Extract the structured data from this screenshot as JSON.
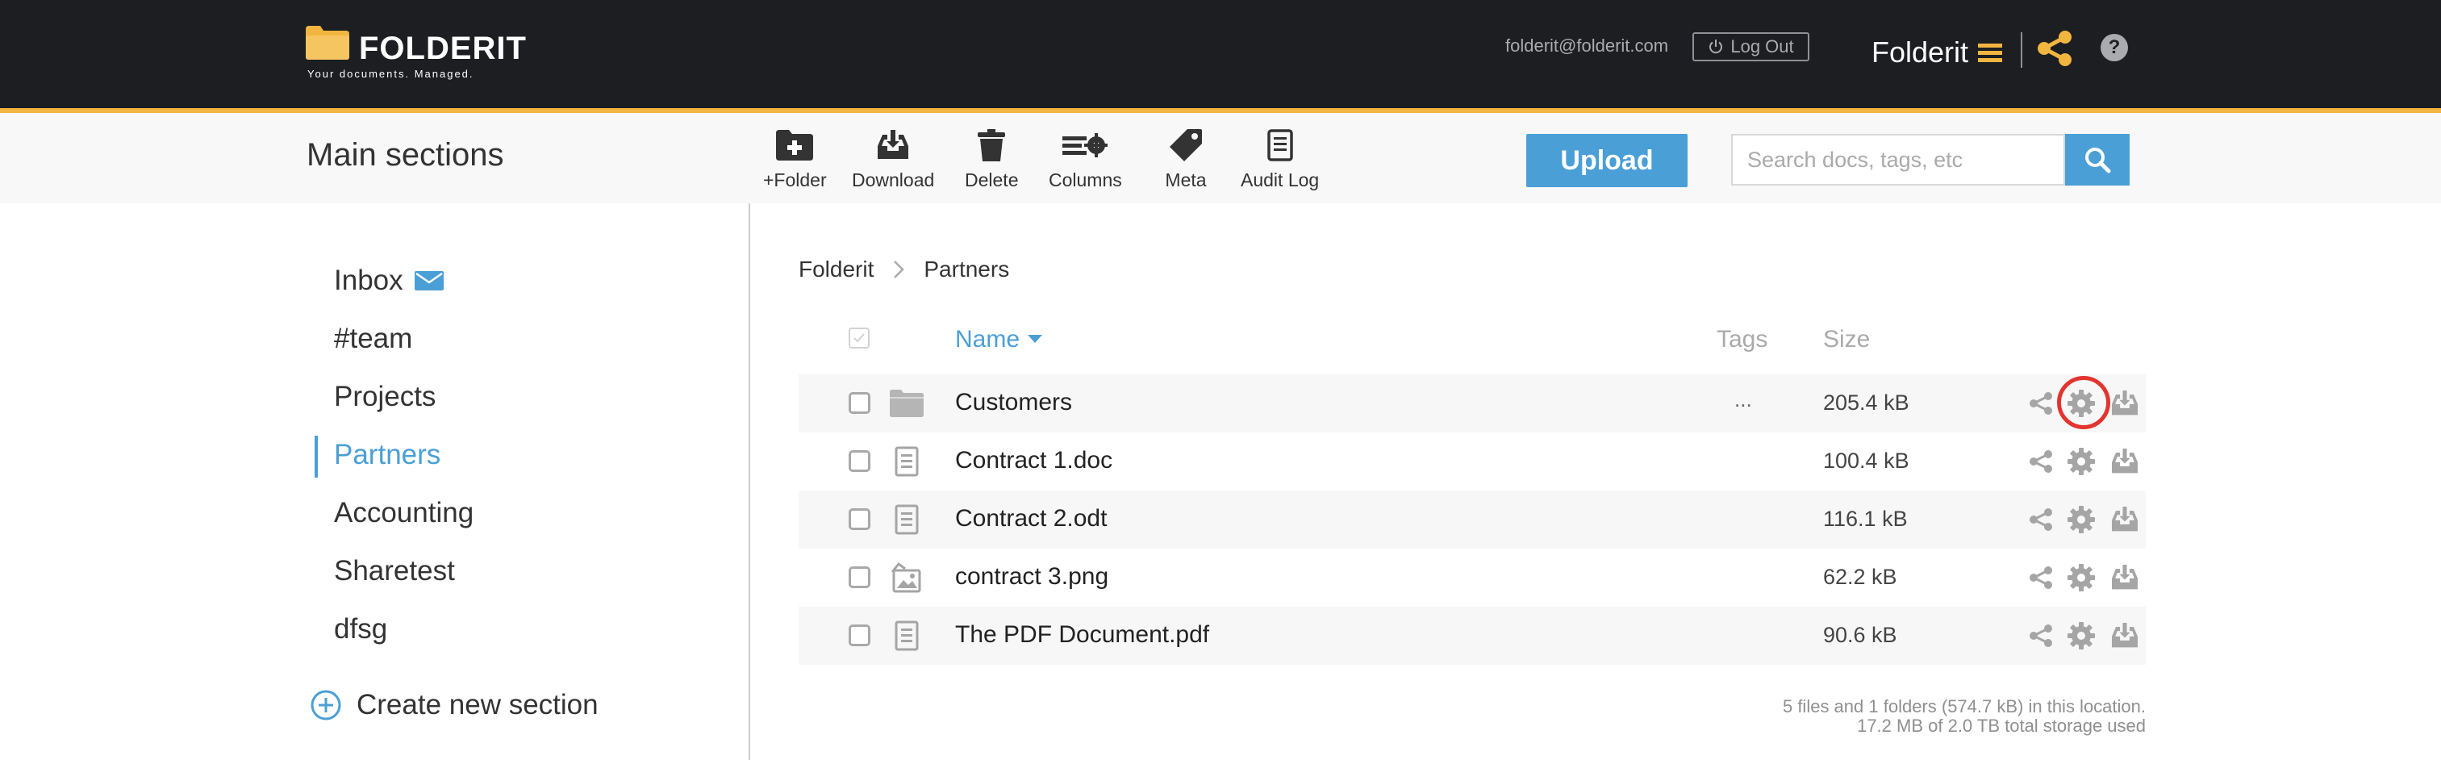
{
  "app": {
    "logo_text": "FOLDERIT",
    "tagline": "Your documents. Managed.",
    "user_email": "folderit@folderit.com",
    "logout_label": "Log Out",
    "brand_menu_label": "Folderit",
    "help_label": "?"
  },
  "colors": {
    "accent": "#4a9fd6",
    "brand_yellow": "#f2b53f",
    "topbar_bg": "#1c1e22",
    "highlight": "#e3342f"
  },
  "toolbar": {
    "title": "Main sections",
    "tools": [
      {
        "label": "+Folder",
        "icon": "new-folder-icon"
      },
      {
        "label": "Download",
        "icon": "download-tray-icon"
      },
      {
        "label": "Delete",
        "icon": "trash-icon"
      },
      {
        "label": "Columns",
        "icon": "columns-settings-icon"
      },
      {
        "label": "Meta",
        "icon": "tag-icon"
      },
      {
        "label": "Audit Log",
        "icon": "audit-log-icon"
      }
    ],
    "upload_label": "Upload",
    "search_placeholder": "Search docs, tags, etc",
    "search_value": ""
  },
  "sidebar": {
    "items": [
      {
        "label": "Inbox",
        "icon": "mail-icon"
      },
      {
        "label": "#team"
      },
      {
        "label": "Projects"
      },
      {
        "label": "Partners",
        "active": true
      },
      {
        "label": "Accounting"
      },
      {
        "label": "Sharetest"
      },
      {
        "label": "dfsg"
      }
    ],
    "create_label": "Create new section"
  },
  "breadcrumb": [
    "Folderit",
    "Partners"
  ],
  "table": {
    "columns": {
      "name": "Name",
      "tags": "Tags",
      "size": "Size"
    },
    "rows": [
      {
        "type": "folder",
        "name": "Customers",
        "tags": "...",
        "size": "205.4 kB"
      },
      {
        "type": "document",
        "name": "Contract 1.doc",
        "tags": "",
        "size": "100.4 kB"
      },
      {
        "type": "document",
        "name": "Contract 2.odt",
        "tags": "",
        "size": "116.1 kB"
      },
      {
        "type": "image",
        "name": "contract 3.png",
        "tags": "",
        "size": "62.2 kB"
      },
      {
        "type": "document",
        "name": "The PDF Document.pdf",
        "tags": "",
        "size": "90.6 kB"
      }
    ]
  },
  "summary": {
    "line1": "5 files and 1 folders (574.7 kB) in this location.",
    "line2": "17.2 MB of 2.0 TB total storage used"
  }
}
